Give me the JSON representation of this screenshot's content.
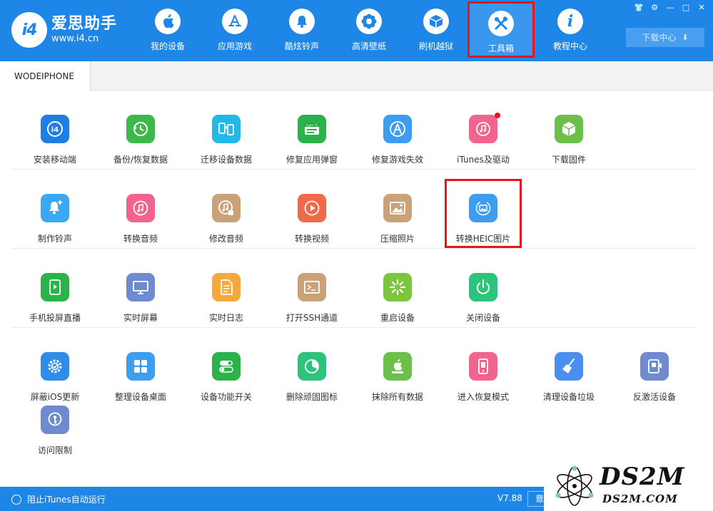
{
  "app": {
    "name": "爱思助手",
    "url": "www.i4.cn",
    "logo_text": "i4"
  },
  "nav": [
    {
      "label": "我的设备",
      "icon": "apple-icon",
      "glyph": ""
    },
    {
      "label": "应用游戏",
      "icon": "app-store-icon",
      "glyph": "A"
    },
    {
      "label": "酷炫铃声",
      "icon": "bell-icon",
      "glyph": "♪"
    },
    {
      "label": "高清壁纸",
      "icon": "flower-icon",
      "glyph": "✿"
    },
    {
      "label": "刷机越狱",
      "icon": "box-icon",
      "glyph": "◈"
    },
    {
      "label": "工具箱",
      "icon": "tools-icon",
      "glyph": "✕",
      "active": true
    },
    {
      "label": "教程中心",
      "icon": "info-icon",
      "glyph": "i"
    }
  ],
  "window_controls": [
    "👕",
    "⚙",
    "—",
    "□",
    "✕"
  ],
  "download_center": "下载中心",
  "device_tab": "WODEIPHONE",
  "tools": [
    [
      {
        "label": "安装移动端",
        "icon": "i4-app-icon",
        "color": "#1e7fe0"
      },
      {
        "label": "备份/恢复数据",
        "icon": "clock-backup-icon",
        "color": "#3db84a"
      },
      {
        "label": "迁移设备数据",
        "icon": "phone-transfer-icon",
        "color": "#22b8e8"
      },
      {
        "label": "修复应用弹窗",
        "icon": "apple-id-icon",
        "color": "#2cb24a"
      },
      {
        "label": "修复游戏失效",
        "icon": "app-store-fix-icon",
        "color": "#3d9df0"
      },
      {
        "label": "iTunes及驱动",
        "icon": "itunes-icon",
        "color": "#f2648e",
        "badge": true
      },
      {
        "label": "下载固件",
        "icon": "cube-icon",
        "color": "#6cc04a"
      }
    ],
    [
      {
        "label": "制作铃声",
        "icon": "bell-plus-icon",
        "color": "#3aa8f2"
      },
      {
        "label": "转换音频",
        "icon": "music-note-icon",
        "color": "#f2648e"
      },
      {
        "label": "修改音频",
        "icon": "music-edit-icon",
        "color": "#c9a27a"
      },
      {
        "label": "转换视频",
        "icon": "play-icon",
        "color": "#f06a4a"
      },
      {
        "label": "压缩照片",
        "icon": "photo-icon",
        "color": "#c9a27a"
      },
      {
        "label": "转换HEIC图片",
        "icon": "heic-photo-icon",
        "color": "#3d9df0"
      }
    ],
    [
      {
        "label": "手机投屏直播",
        "icon": "screen-mirror-icon",
        "color": "#2cb24a"
      },
      {
        "label": "实时屏幕",
        "icon": "monitor-icon",
        "color": "#6f8bd0"
      },
      {
        "label": "实时日志",
        "icon": "document-icon",
        "color": "#f5a93c"
      },
      {
        "label": "打开SSH通道",
        "icon": "terminal-icon",
        "color": "#c9a27a"
      },
      {
        "label": "重启设备",
        "icon": "restart-icon",
        "color": "#7cc53e"
      },
      {
        "label": "关闭设备",
        "icon": "power-icon",
        "color": "#2cc47a"
      }
    ],
    [
      {
        "label": "屏蔽iOS更新",
        "icon": "gear-block-icon",
        "color": "#2f8de8"
      },
      {
        "label": "整理设备桌面",
        "icon": "grid-icon",
        "color": "#3d9df0"
      },
      {
        "label": "设备功能开关",
        "icon": "toggle-icon",
        "color": "#2cb24a"
      },
      {
        "label": "删除顽固图标",
        "icon": "pie-icon",
        "color": "#2cc47a"
      },
      {
        "label": "抹除所有数据",
        "icon": "apple-erase-icon",
        "color": "#6cc04a"
      },
      {
        "label": "进入恢复模式",
        "icon": "phone-recovery-icon",
        "color": "#f2648e"
      },
      {
        "label": "清理设备垃圾",
        "icon": "broom-icon",
        "color": "#4a8fef"
      },
      {
        "label": "反激活设备",
        "icon": "deactivate-icon",
        "color": "#6f8bd0"
      }
    ],
    [
      {
        "label": "访问限制",
        "icon": "key-lock-icon",
        "color": "#6f8bd0"
      }
    ]
  ],
  "status": {
    "itunes_toggle": "阻止iTunes自动运行",
    "version": "V7.88",
    "feedback": "意"
  },
  "watermark": {
    "big": "DS2M",
    "small": "DS2M.COM"
  }
}
